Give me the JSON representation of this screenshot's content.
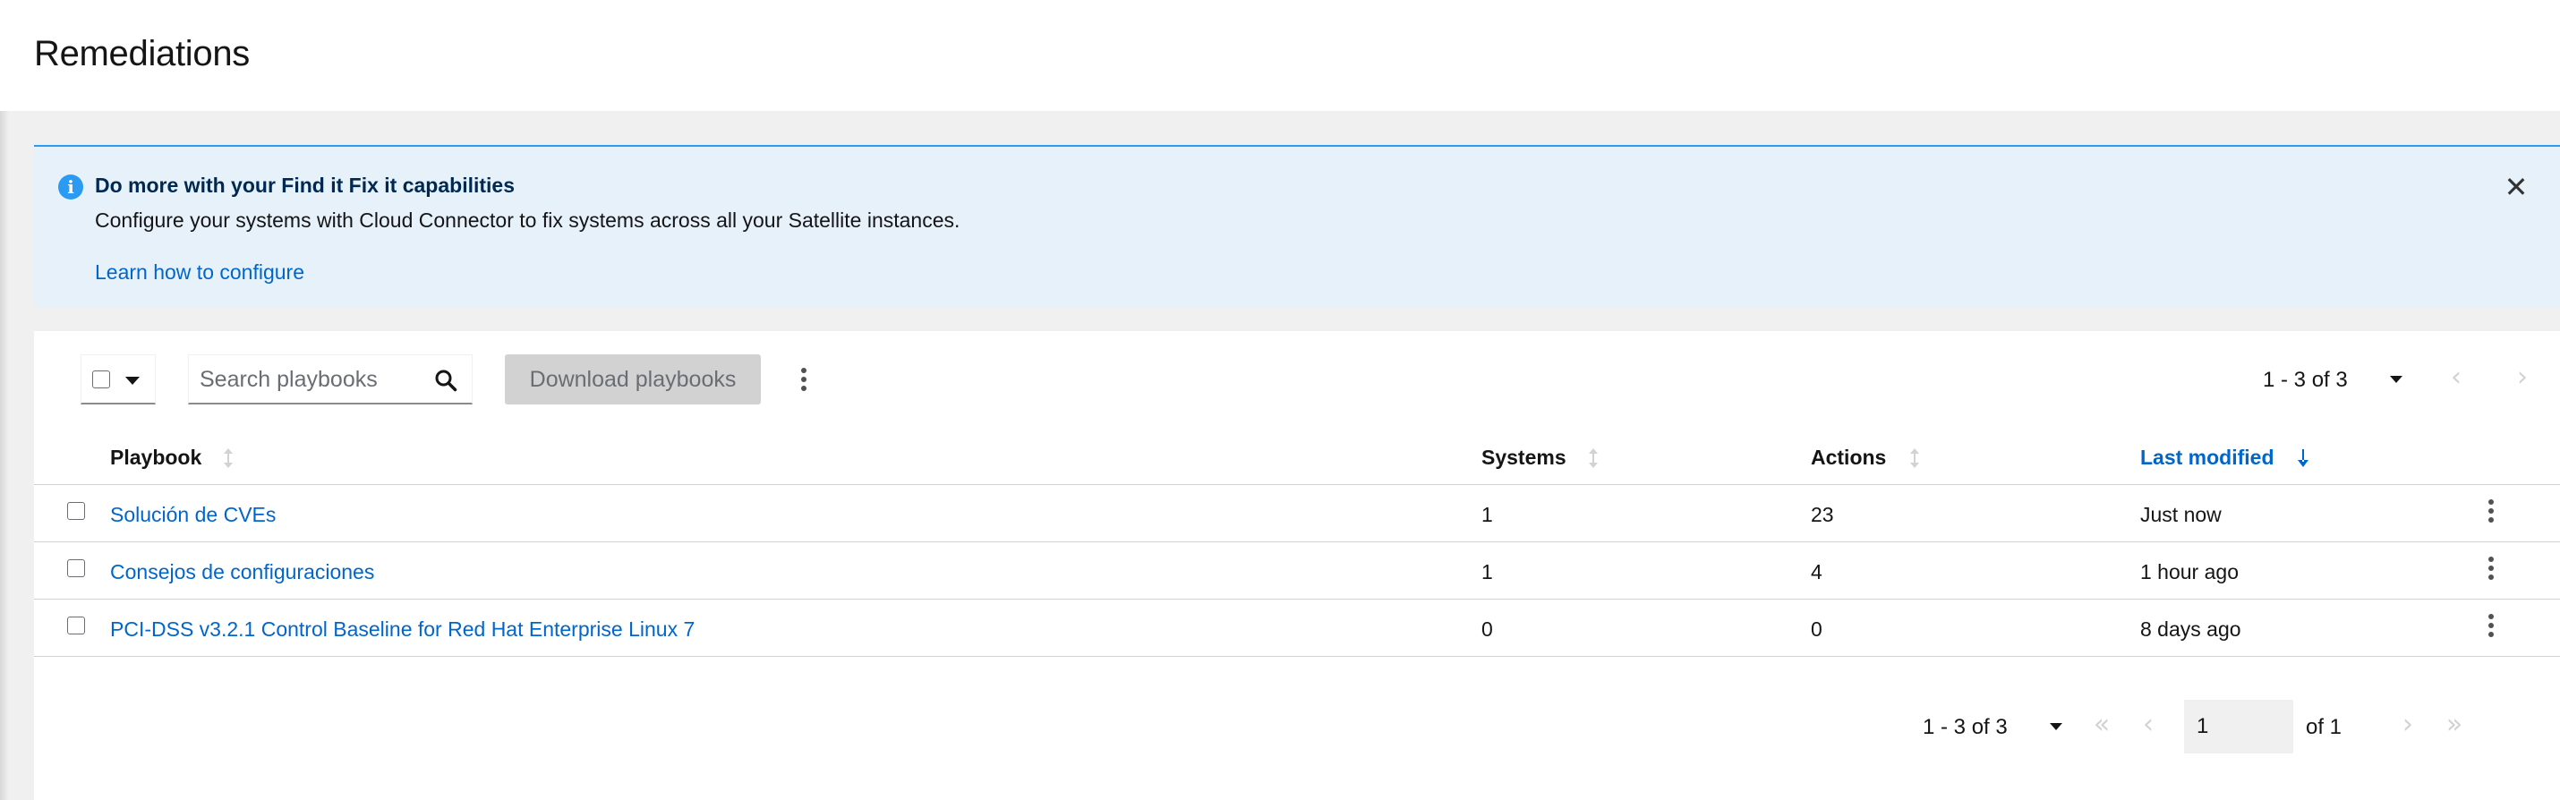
{
  "page": {
    "title": "Remediations"
  },
  "alert": {
    "title": "Do more with your Find it Fix it capabilities",
    "body": "Configure your systems with Cloud Connector to fix systems across all your Satellite instances.",
    "link": "Learn how to configure",
    "icon": "info-icon",
    "close_icon": "close-icon",
    "close_glyph": "✕",
    "info_glyph": "i"
  },
  "toolbar": {
    "search_placeholder": "Search playbooks",
    "search_value": "",
    "download_label": "Download playbooks",
    "download_disabled": true
  },
  "pagination": {
    "range_label": "1 - 3 of 3",
    "current_page": "1",
    "total_pages_label": "of 1",
    "prev_glyph": "‹",
    "next_glyph": "›",
    "first_glyph": "«",
    "last_glyph": "»"
  },
  "table": {
    "columns": [
      {
        "label": "Playbook",
        "sortable": true,
        "active": false
      },
      {
        "label": "Systems",
        "sortable": true,
        "active": false
      },
      {
        "label": "Actions",
        "sortable": true,
        "active": false
      },
      {
        "label": "Last modified",
        "sortable": true,
        "active": true,
        "direction": "desc"
      }
    ],
    "rows": [
      {
        "playbook": "Solución de CVEs",
        "systems": "1",
        "actions": "23",
        "last_modified": "Just now"
      },
      {
        "playbook": "Consejos de configuraciones",
        "systems": "1",
        "actions": "4",
        "last_modified": "1 hour ago"
      },
      {
        "playbook": "PCI-DSS v3.2.1 Control Baseline for Red Hat Enterprise Linux 7",
        "systems": "0",
        "actions": "0",
        "last_modified": "8 days ago"
      }
    ]
  },
  "colors": {
    "link": "#0066cc",
    "alert_bg": "#e7f1fa",
    "alert_accent": "#2b9af3",
    "disabled_btn_bg": "#d2d2d2"
  }
}
